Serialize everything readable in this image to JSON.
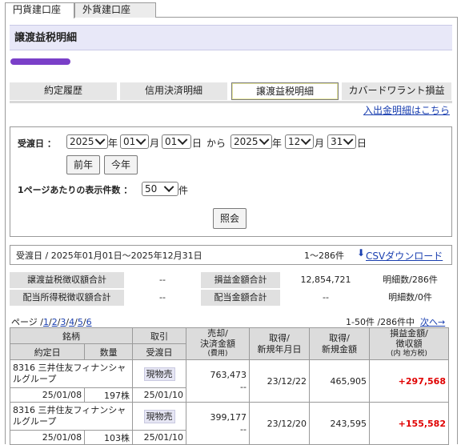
{
  "tabs": {
    "yen": "円貨建口座",
    "foreign": "外貨建口座"
  },
  "page_title": "譲渡益税明細",
  "colors": {
    "accent": "#7a3fc8",
    "positive": "#e00000",
    "link": "#1a3fb0"
  },
  "subtabs": [
    "約定履歴",
    "信用決済明細",
    "譲渡益税明細",
    "カバードワラント損益"
  ],
  "deposit_link": "入出金明細はこちら",
  "filter": {
    "date_label": "受渡日 ：",
    "from_year": "2025",
    "from_month": "01",
    "from_day": "01",
    "to_year": "2025",
    "to_month": "12",
    "to_day": "31",
    "unit_year": "年",
    "unit_month": "月",
    "unit_day": "日",
    "from_word": "から",
    "prev_year_btn": "前年",
    "this_year_btn": "今年",
    "per_page_label": "1ページあたりの表示件数 ：",
    "per_page_value": "50",
    "per_page_unit": "件",
    "submit_btn": "照会"
  },
  "range": {
    "text": "受渡日 / 2025年01月01日〜2025年12月31日",
    "count": "1〜286件",
    "csv": "CSVダウンロード"
  },
  "summary": {
    "r1": [
      "譲渡益税徴収額合計",
      "--",
      "損益金額合計",
      "12,854,721",
      "明細数/286件"
    ],
    "r2": [
      "配当所得税徴収額合計",
      "--",
      "配当金額合計",
      "--",
      "明細数/0件"
    ]
  },
  "pager": {
    "label": "ページ /",
    "pages": [
      "1",
      "2",
      "3",
      "4",
      "5",
      "6"
    ],
    "status": "1-50件 /286件中",
    "next": "次へ→"
  },
  "table": {
    "h_name": "銘柄",
    "h_date": "約定日",
    "h_qty": "数量",
    "h_trade": "取引",
    "h_settle": "受渡日",
    "h_sell1": "売却/",
    "h_sell2": "決済金額",
    "h_sell3": "(費用)",
    "h_acq1": "取得/",
    "h_acq2": "新規年月日",
    "h_acqamt1": "取得/",
    "h_acqamt2": "新規金額",
    "h_pl1": "損益金額/",
    "h_pl2": "徴収額",
    "h_pl3": "(内 地方税)",
    "rows": [
      {
        "name": "8316 三井住友フィナンシャルグループ",
        "trade": "現物売",
        "sell": "763,473",
        "fee": "--",
        "acq_date": "23/12/22",
        "acq_amt": "465,905",
        "pl": "+297,568",
        "date": "25/01/08",
        "qty": "197株",
        "settle": "25/01/10"
      },
      {
        "name": "8316 三井住友フィナンシャルグループ",
        "trade": "現物売",
        "sell": "399,177",
        "fee": "--",
        "acq_date": "23/12/20",
        "acq_amt": "243,595",
        "pl": "+155,582",
        "date": "25/01/08",
        "qty": "103株",
        "settle": "25/01/10"
      }
    ]
  }
}
